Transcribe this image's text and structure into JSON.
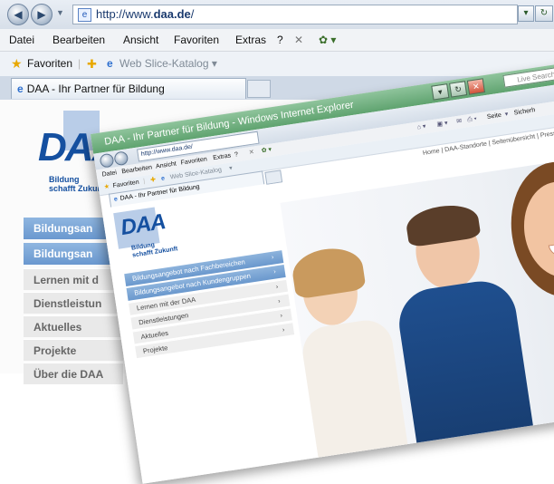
{
  "browser": {
    "address": {
      "prefix": "http://www.",
      "host": "daa.de",
      "suffix": "/"
    },
    "menu": [
      "Datei",
      "Bearbeiten",
      "Ansicht",
      "Favoriten",
      "Extras",
      "?"
    ],
    "favorites": {
      "label": "Favoriten",
      "webslice": "Web Slice-Katalog"
    },
    "tab_title": "DAA - Ihr Partner für Bildung"
  },
  "site": {
    "logo": "DAA",
    "slogan_line1": "Bildung",
    "slogan_line2": "schafft Zukunft",
    "nav": [
      {
        "label": "Bildungsangebot nach Fachbereichen",
        "short": "Bildungsan"
      },
      {
        "label": "Bildungsangebot nach Kundengruppen",
        "short": "Bildungsan"
      },
      {
        "label": "Lernen mit der DAA",
        "short": "Lernen mit d"
      },
      {
        "label": "Dienstleistungen",
        "short": "Dienstleistun"
      },
      {
        "label": "Aktuelles",
        "short": "Aktuelles"
      },
      {
        "label": "Projekte",
        "short": "Projekte"
      },
      {
        "label": "Über die DAA",
        "short": "Über die DAA"
      }
    ],
    "toplinks": "Home | DAA-Standorte | Seitenübersicht | Presse"
  },
  "fg_window": {
    "title": "DAA - Ihr Partner für Bildung - Windows Internet Explorer",
    "search_placeholder": "Live Search",
    "url": "http://www.daa.de/",
    "tab_title": "DAA - Ihr Partner für Bildung",
    "cmd_seite": "Seite",
    "cmd_sicher": "Sicherh"
  }
}
